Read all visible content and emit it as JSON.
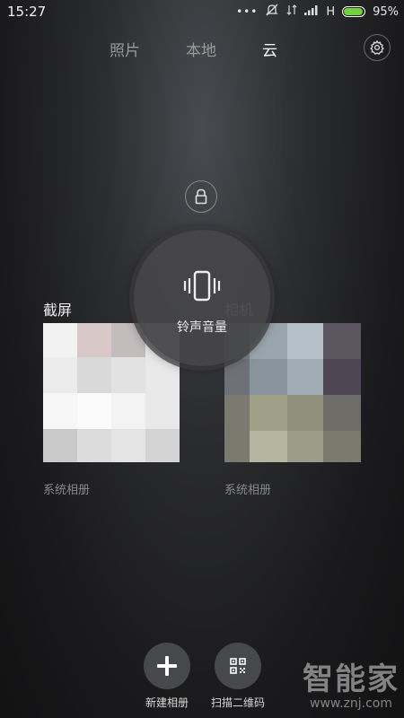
{
  "status_bar": {
    "time": "15:27",
    "network_type": "H",
    "battery_percent": "95%",
    "battery_level": 0.95,
    "icons": [
      "notification-dots-icon",
      "mute-icon",
      "signal-icon",
      "cellular-signal-icon",
      "battery-icon"
    ]
  },
  "nav": {
    "tabs": [
      {
        "label": "照片",
        "active": false
      },
      {
        "label": "本地",
        "active": false
      },
      {
        "label": "云",
        "active": true
      }
    ],
    "settings_icon": "gear-icon"
  },
  "lock_icon": "lock-icon",
  "albums": [
    {
      "title": "截屏",
      "subtitle": "系统相册"
    },
    {
      "title": "相机",
      "subtitle": "系统相册"
    }
  ],
  "volume_overlay": {
    "label": "铃声音量",
    "icon": "phone-vibrate-icon"
  },
  "bottom_actions": [
    {
      "label": "新建相册",
      "icon": "plus-icon"
    },
    {
      "label": "扫描二维码",
      "icon": "qr-code-icon"
    }
  ],
  "watermark": {
    "logo": "智能家",
    "url": "www.znj.com"
  },
  "colors": {
    "background": "#1a1a1c",
    "battery_fill": "#6fd33a",
    "active_tab": "#ffffff",
    "inactive_tab": "#9a9a9a"
  }
}
